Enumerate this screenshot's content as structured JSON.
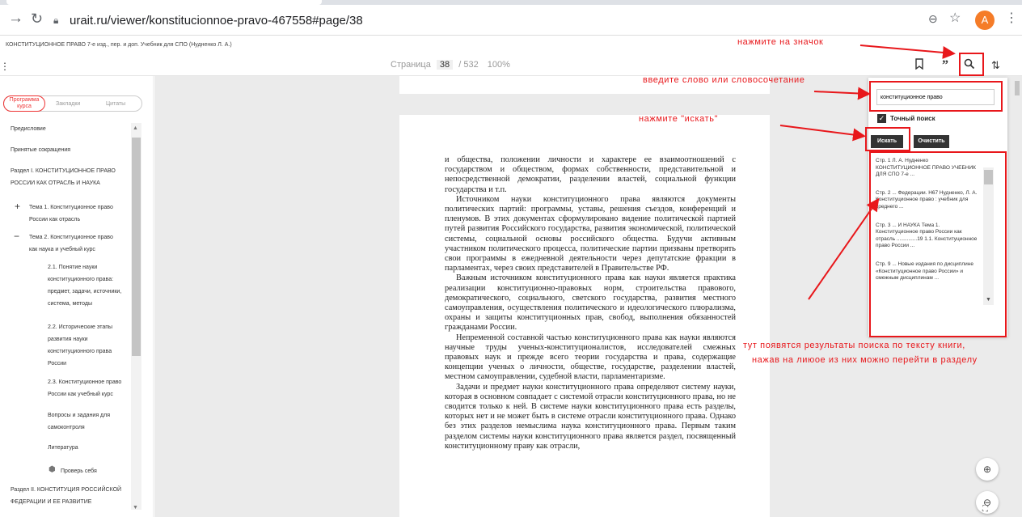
{
  "browser": {
    "url": "urait.ru/viewer/konstitucionnoe-pravo-467558#page/38",
    "avatar_letter": "A"
  },
  "book_title": "КОНСТИТУЦИОННОЕ ПРАВО 7-е изд., пер. и доп. Учебник для СПО (Нудненко Л. А.)",
  "toolbar": {
    "page_label": "Страница",
    "page_number": "38",
    "page_total": "/ 532",
    "zoom": "100%"
  },
  "sidebar": {
    "tabs": [
      "Программа курса",
      "Закладки",
      "Цитаты"
    ],
    "toc": [
      "Предисловие",
      "Принятые сокращения",
      "Раздел I. КОНСТИТУЦИОННОЕ ПРАВО",
      "РОССИИ КАК ОТРАСЛЬ И НАУКА",
      "Тема 1. Конституционное право",
      "России как отрасль",
      "Тема 2. Конституционное право",
      "как наука и учебный курс",
      "2.1. Понятие науки",
      "конституционного права:",
      "предмет, задачи, источники,",
      "система, методы",
      "2.2. Исторические этапы",
      "развития науки",
      "конституционного права",
      "России",
      "2.3. Конституционное право",
      "России как учебный курс",
      "Вопросы и задания для",
      "самоконтроля",
      "Литература",
      "Проверь себя",
      "Раздел II. КОНСТИТУЦИЯ РОССИЙСКОЙ",
      "ФЕДЕРАЦИИ И ЕЕ РАЗВИТИЕ"
    ]
  },
  "page_text": [
    "и общества, положении личности и характере ее взаимоотношений с государством и обществом, формах собственности, представительной и непосредственной демократии, разделении властей, социальной функции государства и т.п.",
    "Источником науки конституционного права являются документы политических партий: программы, уставы, решения съездов, конференций и пленумов. В этих документах сформулировано видение политической партией путей развития Российского государства, развития экономической, политической системы, социальной основы российского общества. Будучи активным участником политического процесса, политические партии призваны претворять свои программы в ежедневной деятельности через депутатские фракции в парламентах, через своих представителей в Правительстве РФ.",
    "Важным источником конституционного права как науки является практика реализации конституционно-правовых норм, строительства правового, демократического, социального, светского государства, развития местного самоуправления, осуществления политического и идеологического плюрализма, охраны и защиты конституционных прав, свобод, выполнения обязанностей гражданами России.",
    "Непременной составной частью конституционного права как науки являются научные труды ученых-конституционалистов, исследователей смежных правовых наук и прежде всего теории государства и права, содержащие концепции ученых о личности, обществе, государстве, разделении властей, местном самоуправлении, судебной власти, парламентаризме.",
    "Задачи и предмет науки конституционного права определяют систему науки, которая в основном совпадает с системой отрасли конституционного права, но не сводится только к ней. В системе науки конституционного права есть разделы, которых нет и не может быть в системе отрасли конституционного права. Однако без этих разделов немыслима наука конституционного права. Первым таким разделом системы науки конституционного права является раздел, посвященный конституционному праву как отрасли,"
  ],
  "search": {
    "value": "конституционное право",
    "exact_label": "Точный поиск",
    "search_button": "Искать",
    "clear_button": "Очистить",
    "results": [
      "Стр. 1 Л. А. Нудненко КОНСТИТУЦИОННОЕ ПРАВО УЧЕБНИК ДЛЯ СПО 7-е ...",
      "Стр. 2 ... Федерации. Н67 Нудненко, Л. А. Конституционное право : учебник для среднего ...",
      "Стр. 3 ... И НАУКА Тема 1. Конституционное право России как отрасль ..............19 1.1. Конституционное право России ...",
      "Стр. 9 ... Новые издания по дисциплине «Конституционное право России» и смежным дисциплинам ..."
    ]
  },
  "annotations": {
    "click_icon": "нажмите на значок",
    "enter_word": "введите слово или словосочетание",
    "press_search": "нажмите \"искать\"",
    "results_line1": "тут появятся результаты поиска по тексту книги,",
    "results_line2": "нажав на лиюое из них можно перейти в разделу"
  },
  "colors": {
    "accent": "#e8171b",
    "avatar": "#f57c28"
  }
}
